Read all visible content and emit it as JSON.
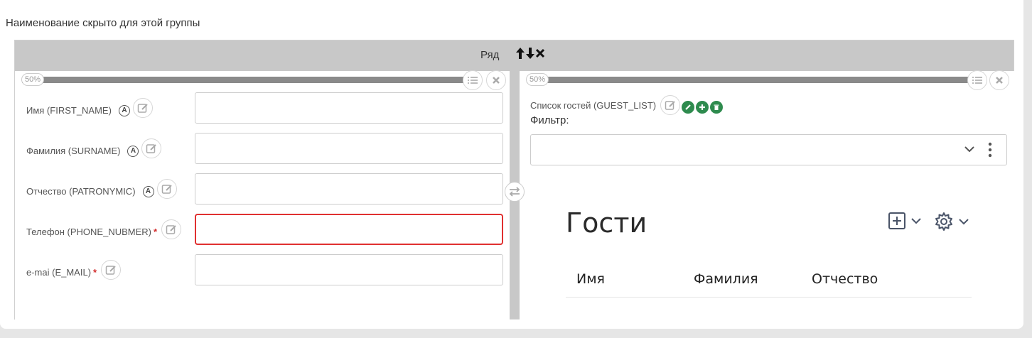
{
  "group_caption": "Наименование скрыто для этой группы",
  "row": {
    "title": "Ряд",
    "controls": [
      "arrow-up-icon",
      "arrow-down-icon",
      "close-icon"
    ]
  },
  "left_column": {
    "width_badge": "50%",
    "fields": [
      {
        "label": "Имя (FIRST_NAME)",
        "required": false,
        "auto": true,
        "value": ""
      },
      {
        "label": "Фамилия (SURNAME)",
        "required": false,
        "auto": true,
        "value": ""
      },
      {
        "label": "Отчество (PATRONYMIC)",
        "required": false,
        "auto": true,
        "value": ""
      },
      {
        "label": "Телефон (PHONE_NUBMER)",
        "required": true,
        "auto": false,
        "value": "",
        "error": true
      },
      {
        "label": "e-mai (E_MAIL)",
        "required": true,
        "auto": false,
        "value": ""
      }
    ],
    "required_mark": "*",
    "auto_mark": "A"
  },
  "right_column": {
    "width_badge": "50%",
    "list_label": "Список гостей (GUEST_LIST)",
    "filter_label": "Фильтр:",
    "filter_value": "",
    "table": {
      "title": "Гости",
      "columns": [
        "Имя",
        "Фамилия",
        "Отчество"
      ]
    }
  },
  "colors": {
    "accent_green": "#2e8b4e",
    "error_red": "#e03030",
    "row_gray": "#c8c8c8"
  }
}
